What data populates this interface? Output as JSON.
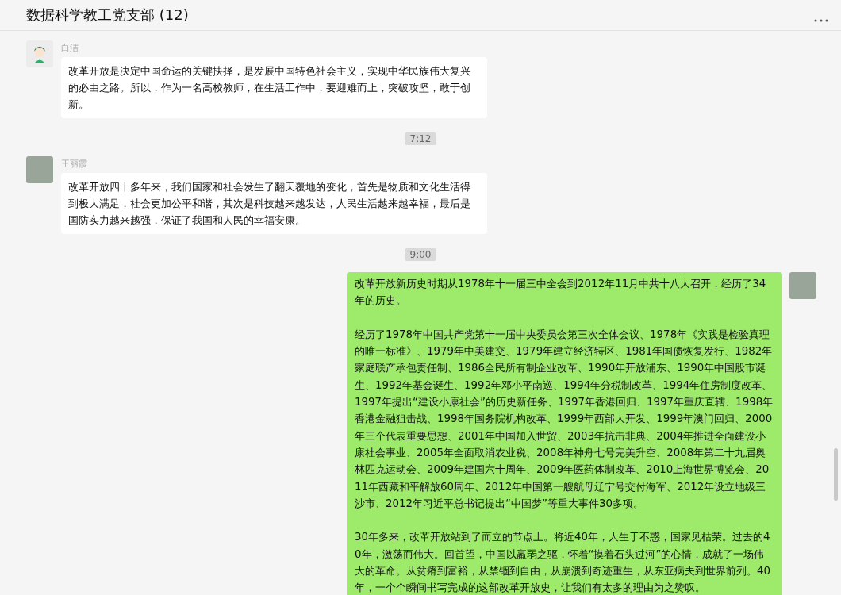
{
  "header": {
    "title": "数据科学教工党支部 (12)"
  },
  "messages": [
    {
      "kind": "incoming",
      "sender": "白洁",
      "avatar": {
        "kind": "cartoon"
      },
      "paragraphs": [
        "改革开放是决定中国命运的关键抉择，是发展中国特色社会主义，实现中华民族伟大复兴的必由之路。所以，作为一名高校教师，在生活工作中，要迎难而上，突破攻坚，敢于创新。"
      ]
    },
    {
      "kind": "timestamp",
      "text": "7:12"
    },
    {
      "kind": "incoming",
      "sender": "王丽霞",
      "avatar": {
        "kind": "photo"
      },
      "paragraphs": [
        "改革开放四十多年来，我们国家和社会发生了翻天覆地的变化，首先是物质和文化生活得到极大满足，社会更加公平和谐，其次是科技越来越发达，人民生活越来越幸福，最后是国防实力越来越强，保证了我国和人民的幸福安康。"
      ]
    },
    {
      "kind": "timestamp",
      "text": "9:00"
    },
    {
      "kind": "outgoing",
      "avatar": {
        "kind": "photo"
      },
      "paragraphs": [
        "改革开放新历史时期从1978年十一届三中全会到2012年11月中共十八大召开，经历了34年的历史。",
        "经历了1978年中国共产党第十一届中央委员会第三次全体会议、1978年《实践是检验真理的唯一标准》、1979年中美建交、1979年建立经济特区、1981年国债恢复发行、1982年家庭联产承包责任制、1986全民所有制企业改革、1990年开放浦东、1990年中国股市诞生、1992年基金诞生、1992年邓小平南巡、1994年分税制改革、1994年住房制度改革、1997年提出“建设小康社会”的历史新任务、1997年香港回归、1997年重庆直辖、1998年香港金融狙击战、1998年国务院机构改革、1999年西部大开发、1999年澳门回归、2000年三个代表重要思想、2001年中国加入世贸、2003年抗击非典、2004年推进全面建设小康社会事业、2005年全面取消农业税、2008年神舟七号完美升空、2008年第二十九届奥林匹克运动会、2009年建国六十周年、2009年医药体制改革、2010上海世界博览会、2011年西藏和平解放60周年、2012年中国第一艘航母辽宁号交付海军、2012年设立地级三沙市、2012年习近平总书记提出“中国梦”等重大事件30多项。",
        "30年多来，改革开放站到了而立的节点上。将近40年，人生于不惑，国家见枯荣。过去的40年，激荡而伟大。回首望，中国以羸弱之驱，怀着“摸着石头过河”的心情，成就了一场伟大的革命。从贫瘠到富裕，从禁锢到自由，从崩溃到奇迹重生，从东亚病夫到世界前列。40年，一个个瞬间书写完成的这部改革开放史，让我们有太多的理由为之赞叹。"
      ]
    }
  ]
}
